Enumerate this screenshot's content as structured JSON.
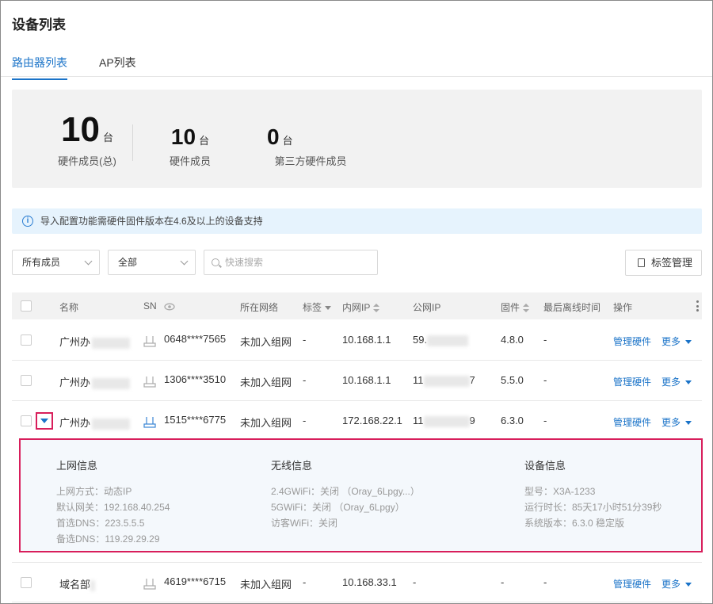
{
  "page_title": "设备列表",
  "tabs": [
    {
      "label": "路由器列表",
      "active": true
    },
    {
      "label": "AP列表",
      "active": false
    }
  ],
  "stats": [
    {
      "num": "10",
      "unit": "台",
      "label": "硬件成员(总)"
    },
    {
      "num": "10",
      "unit": "台",
      "label": "硬件成员"
    },
    {
      "num": "0",
      "unit": "台",
      "label": "第三方硬件成员"
    }
  ],
  "notice": "导入配置功能需硬件固件版本在4.6及以上的设备支持",
  "filters": {
    "member": "所有成员",
    "all": "全部",
    "search_placeholder": "快速搜索",
    "tag_button": "标签管理"
  },
  "columns": {
    "name": "名称",
    "sn": "SN",
    "network": "所在网络",
    "tag": "标签",
    "lan_ip": "内网IP",
    "wan_ip": "公网IP",
    "firmware": "固件",
    "last_offline": "最后离线时间",
    "actions": "操作"
  },
  "rows": [
    {
      "name": "广州办",
      "sn": "0648****7565",
      "network": "未加入组网",
      "tag": "-",
      "lan_ip": "10.168.1.1",
      "wan_ip": "59.",
      "firmware": "4.8.0",
      "last_offline": "-",
      "manage": "管理硬件",
      "more": "更多"
    },
    {
      "name": "广州办",
      "sn": "1306****3510",
      "network": "未加入组网",
      "tag": "-",
      "lan_ip": "10.168.1.1",
      "wan_ip": "11",
      "wan_ip_tail": "7",
      "firmware": "5.5.0",
      "last_offline": "-",
      "manage": "管理硬件",
      "more": "更多"
    },
    {
      "name": "广州办",
      "sn": "1515****6775",
      "network": "未加入组网",
      "tag": "-",
      "lan_ip": "172.168.22.1",
      "wan_ip": "11",
      "wan_ip_tail": "9",
      "firmware": "6.3.0",
      "last_offline": "-",
      "manage": "管理硬件",
      "more": "更多"
    },
    {
      "name": "域名部",
      "sn": "4619****6715",
      "network": "未加入组网",
      "tag": "-",
      "lan_ip": "10.168.33.1",
      "wan_ip": "-",
      "firmware": "-",
      "last_offline": "-",
      "manage": "管理硬件",
      "more": "更多"
    }
  ],
  "detail": {
    "internet": {
      "title": "上网信息",
      "lines": [
        "上网方式：动态IP",
        "默认网关：192.168.40.254",
        "首选DNS：223.5.5.5",
        "备选DNS：119.29.29.29"
      ]
    },
    "wireless": {
      "title": "无线信息",
      "lines": [
        "2.4GWiFi：关闭 （Oray_6Lpgy...）",
        "5GWiFi：关闭 （Oray_6Lpgy）",
        "访客WiFi：关闭"
      ]
    },
    "device": {
      "title": "设备信息",
      "lines": [
        "型号：X3A-1233",
        "运行时长：85天17小时51分39秒",
        "系统版本：6.3.0 稳定版"
      ]
    }
  }
}
